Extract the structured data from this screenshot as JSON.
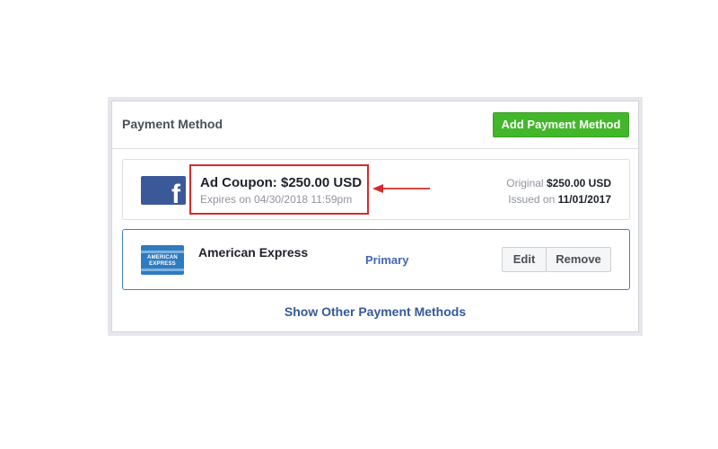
{
  "panel": {
    "title": "Payment Method",
    "add_button_label": "Add Payment Method"
  },
  "coupon": {
    "logo": "facebook-logo",
    "title": "Ad Coupon: $250.00 USD",
    "expiry": "Expires on 04/30/2018 11:59pm",
    "original_label": "Original",
    "original_value": "$250.00 USD",
    "issued_label": "Issued on",
    "issued_value": "11/01/2017",
    "highlight_color": "#d62b2b"
  },
  "card": {
    "logo": "american-express-logo",
    "logo_text_line1": "AMERICAN",
    "logo_text_line2": "EXPRESS",
    "name": "American Express",
    "status": "Primary",
    "edit_label": "Edit",
    "remove_label": "Remove"
  },
  "footer": {
    "show_other_label": "Show Other Payment Methods"
  },
  "colors": {
    "accent_green": "#42b72a",
    "link_blue": "#365899",
    "facebook_blue": "#3b5998",
    "amex_blue": "#2f7bc0"
  }
}
